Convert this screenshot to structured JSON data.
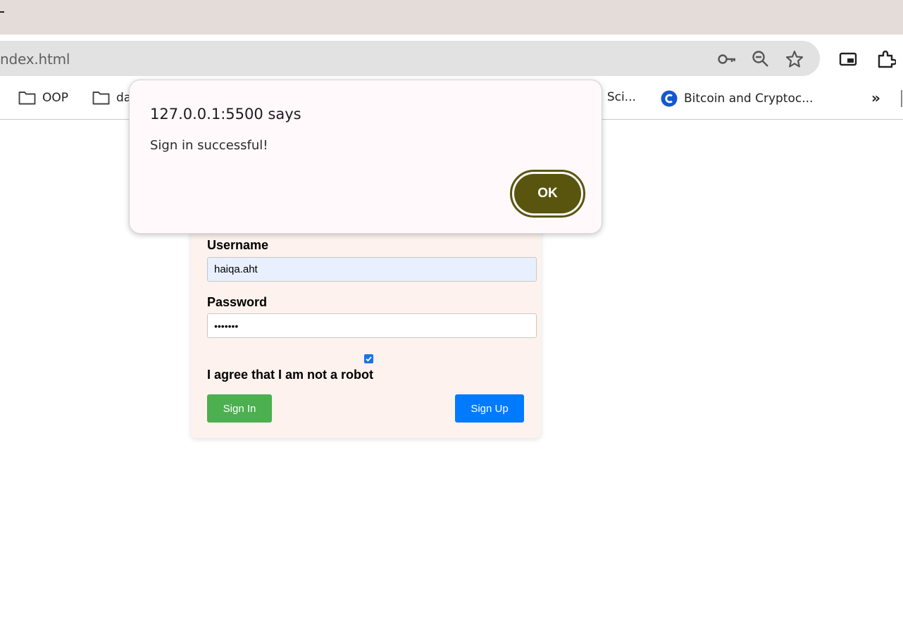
{
  "browser": {
    "url": "ndex.html",
    "bookmarks": [
      {
        "label": "OOP",
        "icon": "folder-icon"
      },
      {
        "label": "da",
        "icon": "folder-icon"
      },
      {
        "label": "a Sci...",
        "icon": ""
      },
      {
        "label": "Bitcoin and Cryptoc...",
        "icon": "coin-logo-icon"
      }
    ],
    "icons": [
      "key-icon",
      "zoom-icon",
      "star-icon",
      "picture-in-picture-icon",
      "extensions-icon",
      "chevron-double-right-icon"
    ],
    "colors": {
      "tabstrip": "#e3dcd9",
      "omnibox": "#e2e2e2"
    }
  },
  "form": {
    "username_label": "Username",
    "username_value": "haiqa.aht",
    "password_label": "Password",
    "password_value": "•••••••",
    "robot_label": "I agree that I am not a robot",
    "robot_checked": true,
    "sign_in_label": "Sign In",
    "sign_up_label": "Sign Up",
    "colors": {
      "card": "#fdf2ee",
      "sign_in": "#4caf50",
      "sign_up": "#007bff",
      "autofill": "#e8f0fe"
    }
  },
  "dialog": {
    "title": "127.0.0.1:5500 says",
    "message": "Sign in successful!",
    "ok_label": "OK",
    "colors": {
      "ok": "#59550e",
      "background": "#fff9fb"
    }
  }
}
